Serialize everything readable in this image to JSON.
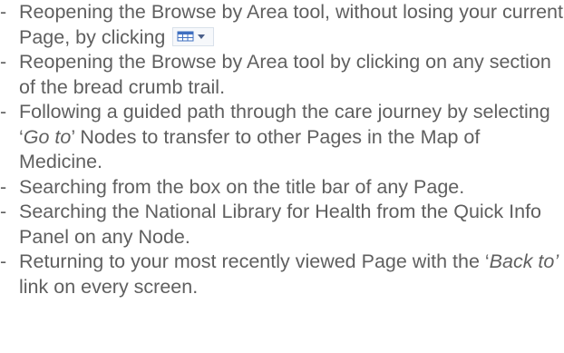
{
  "bullet": "-",
  "items": [
    {
      "pre": "Reopening the Browse by Area tool, without losing your current Page, by clicking",
      "em": "",
      "post": "",
      "icon": "browse-by-area-tool-icon"
    },
    {
      "pre": "Reopening the Browse by Area tool by clicking on any section of the bread crumb trail.",
      "em": "",
      "post": ""
    },
    {
      "pre": "Following a guided path through the care journey by selecting ‘",
      "em": "Go to",
      "post": "’ Nodes to transfer to other Pages in the Map of Medicine."
    },
    {
      "pre": "Searching from the box on the title bar of any Page.",
      "em": "",
      "post": ""
    },
    {
      "pre": "Searching the National Library for Health from the Quick Info Panel on any Node.",
      "em": "",
      "post": ""
    },
    {
      "pre": "Returning to your most recently viewed Page with the ‘",
      "em": "Back to’",
      "post": " link on every screen."
    }
  ],
  "colors": {
    "text": "#5f5f5f",
    "icon_grid": "#3f6fc0",
    "icon_arrow": "#4a5f8a"
  }
}
